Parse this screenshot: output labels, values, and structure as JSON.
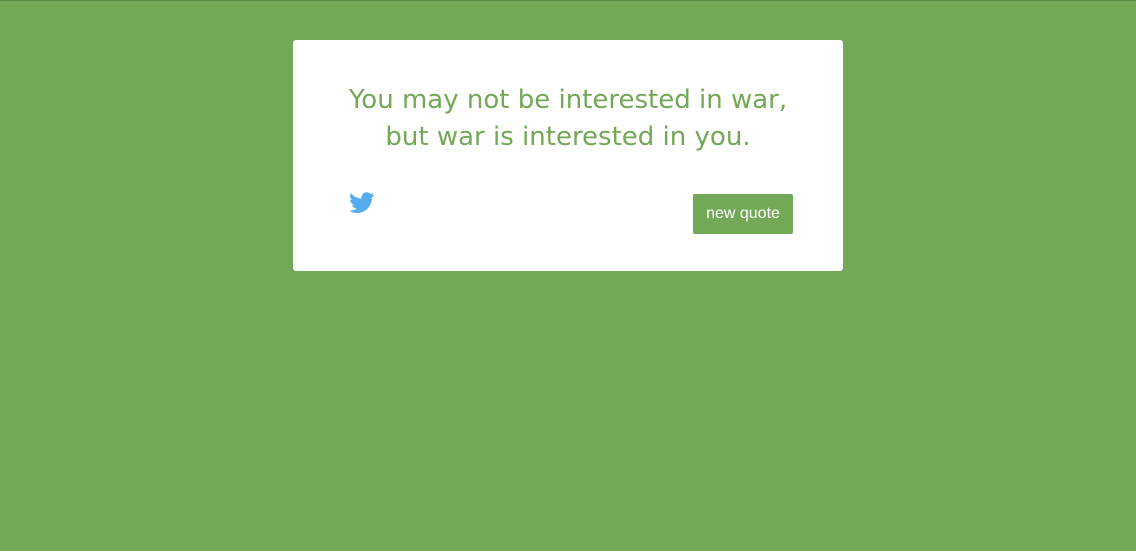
{
  "quote": {
    "text": "You may not be interested in war, but war is interested in you."
  },
  "actions": {
    "tweet_icon": "twitter-icon",
    "new_quote_label": "new quote"
  },
  "colors": {
    "background": "#73a857",
    "accent": "#73a857",
    "card": "#ffffff",
    "twitter": "#55acee"
  }
}
